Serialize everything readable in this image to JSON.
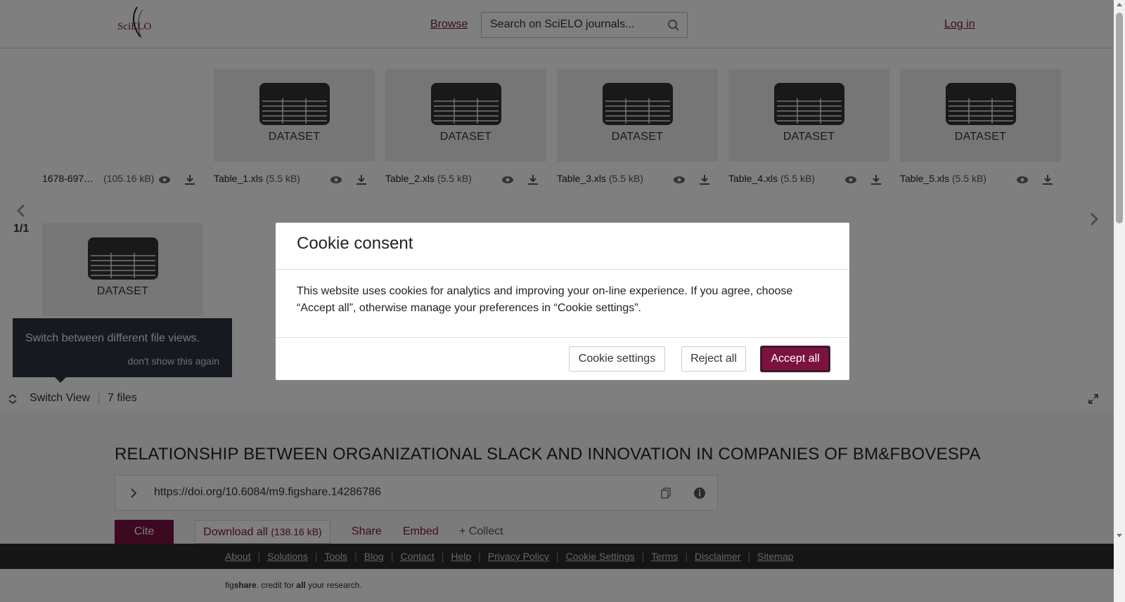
{
  "header": {
    "logo_text": "SciELO",
    "browse_label": "Browse",
    "search_placeholder": "Search on SciELO journals...",
    "login_label": "Log in"
  },
  "viewer": {
    "tiles": [
      {
        "label": "DATASET",
        "name": "Table_1.xls",
        "size": "(5.5 kB)"
      },
      {
        "label": "DATASET",
        "name": "Table_2.xls",
        "size": "(5.5 kB)"
      },
      {
        "label": "DATASET",
        "name": "Table_3.xls",
        "size": "(5.5 kB)"
      },
      {
        "label": "DATASET",
        "name": "Table_4.xls",
        "size": "(5.5 kB)"
      },
      {
        "label": "DATASET",
        "name": "Table_5.xls",
        "size": "(5.5 kB)"
      }
    ],
    "first_file": {
      "name": "1678-697…",
      "size": "(105.16 kB)"
    },
    "second_row_tile_label": "DATASET",
    "pager": "1/1",
    "tooltip_text": "Switch between different file views.",
    "tooltip_dismiss": "don't show this again",
    "switch_view_label": "Switch View",
    "files_count": "7 files"
  },
  "details": {
    "title": "RELATIONSHIP BETWEEN ORGANIZATIONAL SLACK AND INNOVATION IN COMPANIES OF BM&FBOVESPA",
    "doi": "https://doi.org/10.6084/m9.figshare.14286786",
    "cite_label": "Cite",
    "download_label": "Download all",
    "download_size": "(138.16 kB)",
    "share_label": "Share",
    "embed_label": "Embed",
    "collect_label": "+ Collect"
  },
  "footer": {
    "links": [
      "About",
      "Solutions",
      "Tools",
      "Blog",
      "Contact",
      "Help",
      "Privacy Policy",
      "Cookie Settings",
      "Terms",
      "Disclaimer",
      "Sitemap"
    ],
    "brand_fig": "fig",
    "brand_share": "share",
    "brand_mid": ". credit for ",
    "brand_all": "all",
    "brand_end": " your research."
  },
  "cookie_dialog": {
    "title": "Cookie consent",
    "body": "This website uses cookies for analytics and improving your on-line experience. If you agree, choose “Accept all”, otherwise manage your preferences in “Cookie settings”.",
    "settings_label": "Cookie settings",
    "reject_label": "Reject all",
    "accept_label": "Accept all"
  },
  "colors": {
    "brand": "#7b1240",
    "overlay": "rgba(0,0,0,0.5)",
    "tooltip_bg": "#2c3440"
  },
  "icons": [
    "search-icon",
    "eye-icon",
    "download-icon",
    "chevron-left-icon",
    "chevron-right-icon",
    "switch-view-icon",
    "fullscreen-icon",
    "chevron-right-icon",
    "copy-icon",
    "info-icon",
    "dataset-table-icon"
  ]
}
